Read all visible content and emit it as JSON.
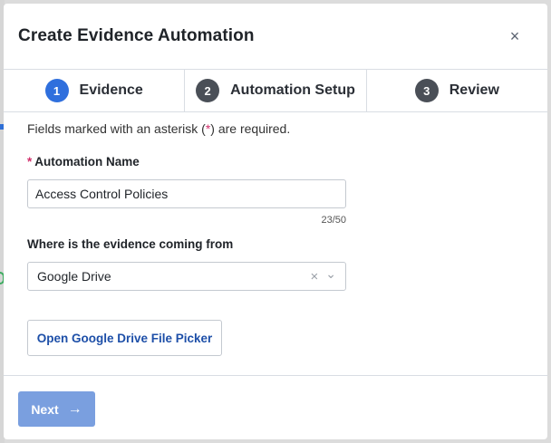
{
  "modal": {
    "title": "Create Evidence Automation",
    "close_icon": "close-icon",
    "close_glyph": "×"
  },
  "steps": [
    {
      "number": "1",
      "label": "Evidence",
      "active": true
    },
    {
      "number": "2",
      "label": "Automation Setup",
      "active": false
    },
    {
      "number": "3",
      "label": "Review",
      "active": false
    }
  ],
  "form": {
    "required_note_prefix": "Fields marked with an asterisk (",
    "required_note_asterisk": "*",
    "required_note_suffix": ") are required.",
    "automation_name": {
      "asterisk": "*",
      "label": "Automation Name",
      "value": "Access Control Policies",
      "counter": "23/50"
    },
    "evidence_source": {
      "label": "Where is the evidence coming from",
      "value": "Google Drive",
      "clear_glyph": "×",
      "chevron_glyph": "⌄"
    },
    "picker_button": "Open Google Drive File Picker"
  },
  "footer": {
    "next_label": "Next",
    "next_arrow": "→"
  },
  "colors": {
    "accent": "#2f6fdd",
    "next_button": "#7a9fdf",
    "required": "#d12f6b",
    "link_button_text": "#1d4fa8"
  }
}
